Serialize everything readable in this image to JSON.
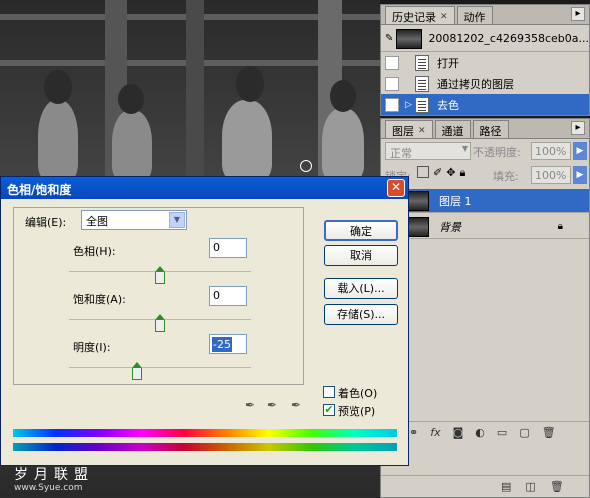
{
  "history": {
    "tabs": [
      {
        "label": "历史记录"
      },
      {
        "label": "动作"
      }
    ],
    "snapshot": "20081202_c4269358ceb0a...",
    "items": [
      {
        "label": "打开"
      },
      {
        "label": "通过拷贝的图层"
      },
      {
        "label": "去色"
      }
    ]
  },
  "layers": {
    "tabs": [
      {
        "label": "图层"
      },
      {
        "label": "通道"
      },
      {
        "label": "路径"
      }
    ],
    "blend_mode": "正常",
    "opacity_label": "不透明度:",
    "opacity": "100%",
    "lock_label": "锁定:",
    "fill_label": "填充:",
    "fill": "100%",
    "rows": [
      {
        "name": "图层 1"
      },
      {
        "name": "背景"
      }
    ]
  },
  "dialog": {
    "title": "色相/饱和度",
    "close": "✕",
    "edit_label": "编辑(E):",
    "edit_value": "全图",
    "hue_label": "色相(H):",
    "hue": "0",
    "sat_label": "饱和度(A):",
    "sat": "0",
    "light_label": "明度(I):",
    "light": "-25",
    "ok": "确定",
    "cancel": "取消",
    "load": "载入(L)...",
    "save": "存储(S)...",
    "colorize": "着色(O)",
    "preview": "预览(P)",
    "colorize_checked": false,
    "preview_checked": true,
    "hue_level": 0.5,
    "sat_level": 0.5,
    "light_level": 0.375
  },
  "watermark": {
    "line1": "岁月联盟",
    "line2": "www.Syue.com"
  },
  "colors": {
    "title_bar": "#0a52c9",
    "selection": "#316ac5",
    "dialog_bg": "#ece9d8",
    "panel_bg": "#d4d0c8"
  }
}
